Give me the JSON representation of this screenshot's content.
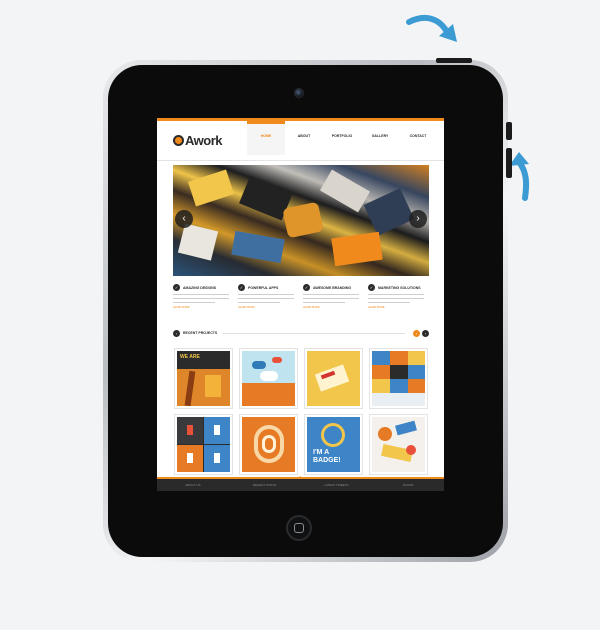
{
  "site": {
    "logo_text": "Awork",
    "nav": [
      {
        "label": "HOME",
        "sub": "",
        "active": true
      },
      {
        "label": "ABOUT",
        "sub": "",
        "active": false
      },
      {
        "label": "PORTFOLIO",
        "sub": "",
        "active": false
      },
      {
        "label": "GALLERY",
        "sub": "",
        "active": false
      },
      {
        "label": "CONTACT",
        "sub": "",
        "active": false
      }
    ],
    "slider": {
      "prev_icon": "chevron-left-icon",
      "next_icon": "chevron-right-icon"
    },
    "features": [
      {
        "title": "AMAZING DESIGNS",
        "more": "LEARN MORE"
      },
      {
        "title": "POWERFUL APPS",
        "more": "LEARN MORE"
      },
      {
        "title": "AWESOME BRANDING",
        "more": "LEARN MORE"
      },
      {
        "title": "MARKETING SOLUTIONS",
        "more": "LEARN MORE"
      }
    ],
    "recent": {
      "title": "RECENT PROJECTS"
    },
    "projects": [
      {
        "label": "WE ARE"
      },
      {
        "label": ""
      },
      {
        "label": ""
      },
      {
        "label": ""
      },
      {
        "label": ""
      },
      {
        "label": ""
      },
      {
        "label": "I'M A BADGE!"
      },
      {
        "label": ""
      }
    ],
    "footer": [
      "ABOUT US",
      "RECENT POSTS",
      "LATEST TWEETS",
      "FLICKR"
    ]
  },
  "colors": {
    "accent": "#f08a1c",
    "dark": "#2b2b2b",
    "arrow": "#3d9bd3"
  }
}
